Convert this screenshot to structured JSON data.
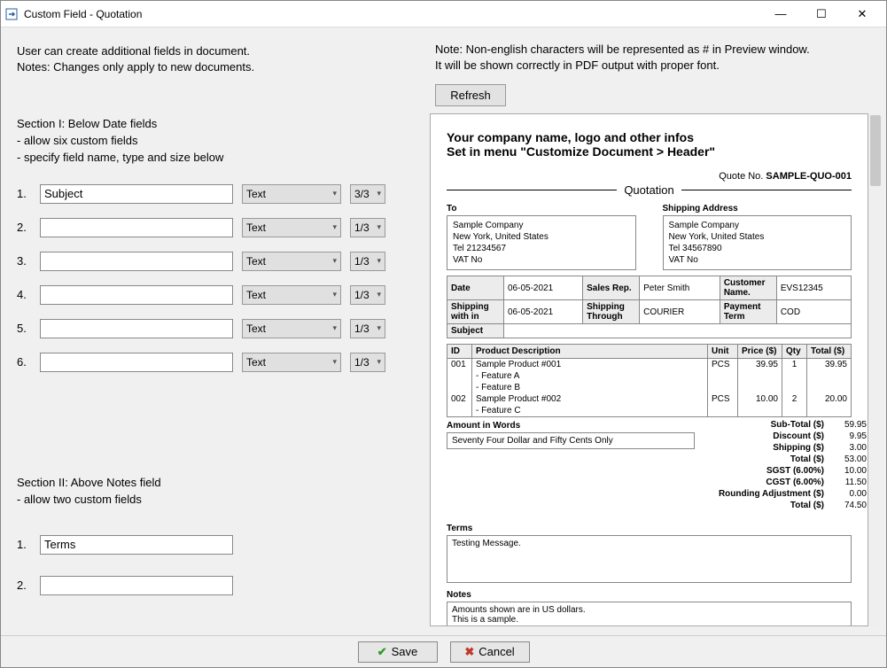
{
  "window": {
    "title": "Custom Field - Quotation"
  },
  "left": {
    "instr1": "User can create additional fields in document.",
    "instr2": "Notes: Changes only apply to new documents.",
    "section1_title": "Section I: Below Date fields",
    "section1_line2": "- allow six custom fields",
    "section1_line3": "- specify field name, type and size below",
    "fields": [
      {
        "num": "1.",
        "name": "Subject",
        "type": "Text",
        "size": "3/3"
      },
      {
        "num": "2.",
        "name": "",
        "type": "Text",
        "size": "1/3"
      },
      {
        "num": "3.",
        "name": "",
        "type": "Text",
        "size": "1/3"
      },
      {
        "num": "4.",
        "name": "",
        "type": "Text",
        "size": "1/3"
      },
      {
        "num": "5.",
        "name": "",
        "type": "Text",
        "size": "1/3"
      },
      {
        "num": "6.",
        "name": "",
        "type": "Text",
        "size": "1/3"
      }
    ],
    "section2_title": "Section II: Above Notes field",
    "section2_line2": "- allow two custom fields",
    "fields2": [
      {
        "num": "1.",
        "name": "Terms"
      },
      {
        "num": "2.",
        "name": ""
      }
    ]
  },
  "right": {
    "note1": "Note: Non-english characters will be represented as # in Preview window.",
    "note2": "It will be shown correctly in PDF output with proper font.",
    "refresh": "Refresh"
  },
  "preview": {
    "header1": "Your company name, logo and other infos",
    "header2": "Set in menu \"Customize Document > Header\"",
    "quote_no_label": "Quote No.",
    "quote_no": "SAMPLE-QUO-001",
    "doc_title": "Quotation",
    "to_label": "To",
    "ship_label": "Shipping Address",
    "to_lines": "Sample Company\nNew York, United States\nTel 21234567\nVAT No",
    "ship_lines": "Sample Company\nNew York, United States\nTel 34567890\nVAT No",
    "meta": {
      "date_l": "Date",
      "date_v": "06-05-2021",
      "rep_l": "Sales Rep.",
      "rep_v": "Peter Smith",
      "cust_l": "Customer Name.",
      "cust_v": "EVS12345",
      "sw_l": "Shipping with in",
      "sw_v": "06-05-2021",
      "st_l": "Shipping Through",
      "st_v": "COURIER",
      "pt_l": "Payment Term",
      "pt_v": "COD",
      "subj_l": "Subject",
      "subj_v": ""
    },
    "items_head": {
      "id": "ID",
      "desc": "Product Description",
      "unit": "Unit",
      "price": "Price ($)",
      "qty": "Qty",
      "total": "Total ($)"
    },
    "items": [
      {
        "id": "001",
        "desc": "Sample Product #001",
        "f1": "- Feature A",
        "f2": "- Feature B",
        "unit": "PCS",
        "price": "39.95",
        "qty": "1",
        "total": "39.95"
      },
      {
        "id": "002",
        "desc": "Sample Product #002",
        "f1": "- Feature C",
        "unit": "PCS",
        "price": "10.00",
        "qty": "2",
        "total": "20.00"
      }
    ],
    "aiw_label": "Amount in Words",
    "aiw": "Seventy Four Dollar and Fifty Cents Only",
    "totals": [
      {
        "l": "Sub-Total ($)",
        "v": "59.95"
      },
      {
        "l": "Discount ($)",
        "v": "9.95"
      },
      {
        "l": "Shipping ($)",
        "v": "3.00"
      },
      {
        "l": "Total ($)",
        "v": "53.00"
      },
      {
        "l": "SGST (6.00%)",
        "v": "10.00"
      },
      {
        "l": "CGST (6.00%)",
        "v": "11.50"
      },
      {
        "l": "Rounding Adjustment ($)",
        "v": "0.00"
      },
      {
        "l": "Total ($)",
        "v": "74.50"
      }
    ],
    "terms_label": "Terms",
    "terms": "Testing Message.",
    "notes_label": "Notes",
    "notes": "Amounts shown are in US dollars.\nThis is a sample."
  },
  "buttons": {
    "save": "Save",
    "cancel": "Cancel"
  }
}
